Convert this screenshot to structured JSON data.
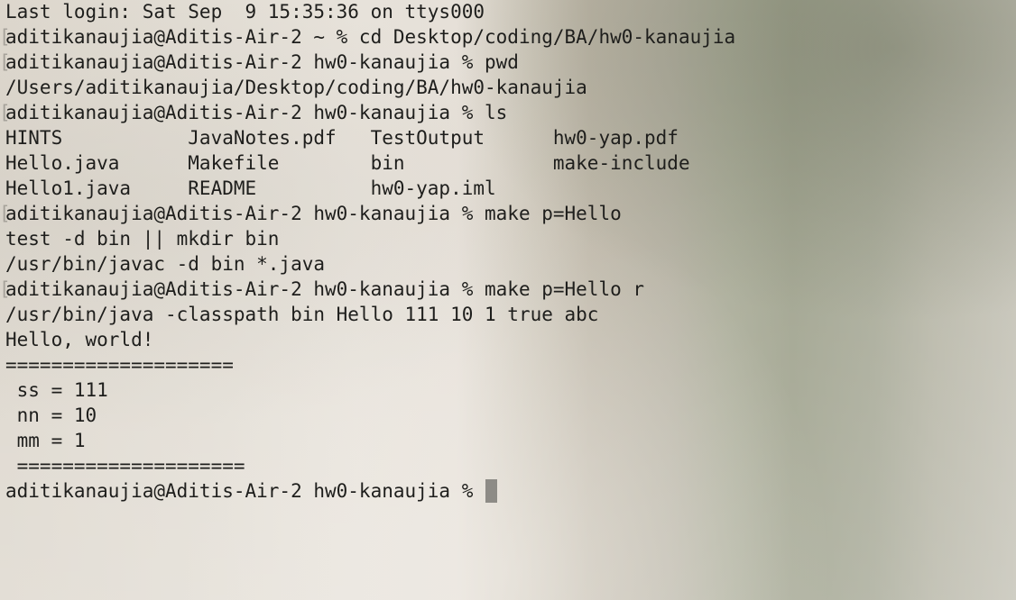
{
  "terminal": {
    "lines": [
      {
        "text": "Last login: Sat Sep  9 15:35:36 on ttys000",
        "marked": false
      },
      {
        "text": "aditikanaujia@Aditis-Air-2 ~ % cd Desktop/coding/BA/hw0-kanaujia",
        "marked": true
      },
      {
        "text": "aditikanaujia@Aditis-Air-2 hw0-kanaujia % pwd",
        "marked": true
      },
      {
        "text": "/Users/aditikanaujia/Desktop/coding/BA/hw0-kanaujia",
        "marked": false
      },
      {
        "text": "aditikanaujia@Aditis-Air-2 hw0-kanaujia % ls",
        "marked": true
      },
      {
        "text": "HINTS           JavaNotes.pdf   TestOutput      hw0-yap.pdf",
        "marked": false
      },
      {
        "text": "Hello.java      Makefile        bin             make-include",
        "marked": false
      },
      {
        "text": "Hello1.java     README          hw0-yap.iml",
        "marked": false
      },
      {
        "text": "aditikanaujia@Aditis-Air-2 hw0-kanaujia % make p=Hello",
        "marked": true
      },
      {
        "text": "test -d bin || mkdir bin",
        "marked": false
      },
      {
        "text": "/usr/bin/javac -d bin *.java",
        "marked": false
      },
      {
        "text": "aditikanaujia@Aditis-Air-2 hw0-kanaujia % make p=Hello r",
        "marked": true
      },
      {
        "text": "/usr/bin/java -classpath bin Hello 111 10 1 true abc",
        "marked": false
      },
      {
        "text": "Hello, world!",
        "marked": false
      },
      {
        "text": "====================",
        "marked": false
      },
      {
        "text": " ss = 111",
        "marked": false
      },
      {
        "text": " nn = 10",
        "marked": false
      },
      {
        "text": " mm = 1",
        "marked": false
      },
      {
        "text": " ====================",
        "marked": false
      }
    ],
    "prompt": "aditikanaujia@Aditis-Air-2 hw0-kanaujia % "
  }
}
